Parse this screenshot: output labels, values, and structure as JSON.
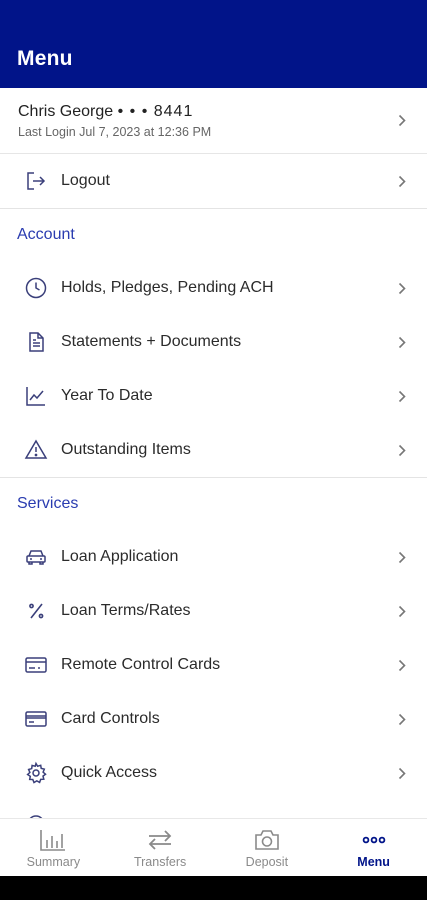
{
  "app": {
    "title": "Menu"
  },
  "user": {
    "name": "Chris George",
    "masked_account": "• • • 8441",
    "last_login": "Last Login Jul 7, 2023 at 12:36 PM"
  },
  "logout": {
    "label": "Logout",
    "icon": "logout-icon"
  },
  "account_section": {
    "header": "Account",
    "items": [
      {
        "label": "Holds, Pledges, Pending ACH",
        "icon": "clock-icon"
      },
      {
        "label": "Statements + Documents",
        "icon": "document-icon"
      },
      {
        "label": "Year To Date",
        "icon": "line-chart-icon"
      },
      {
        "label": "Outstanding Items",
        "icon": "warning-icon"
      }
    ]
  },
  "services_section": {
    "header": "Services",
    "items": [
      {
        "label": "Loan Application",
        "icon": "car-icon"
      },
      {
        "label": "Loan Terms/Rates",
        "icon": "percent-icon"
      },
      {
        "label": "Remote Control Cards",
        "icon": "credit-card-icon"
      },
      {
        "label": "Card Controls",
        "icon": "card-controls-icon"
      },
      {
        "label": "Quick Access",
        "icon": "gear-icon"
      }
    ]
  },
  "bottom_nav": {
    "items": [
      {
        "label": "Summary",
        "icon": "bar-chart-icon",
        "active": false
      },
      {
        "label": "Transfers",
        "icon": "transfer-arrows-icon",
        "active": false
      },
      {
        "label": "Deposit",
        "icon": "camera-icon",
        "active": false
      },
      {
        "label": "Menu",
        "icon": "more-dots-icon",
        "active": true
      }
    ]
  },
  "colors": {
    "brand": "#011489",
    "section_header": "#2a3cb0",
    "icon": "#3a3f7a"
  }
}
